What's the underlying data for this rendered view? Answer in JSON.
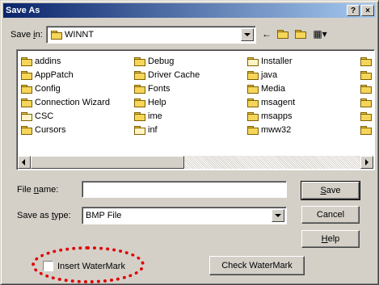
{
  "title": "Save As",
  "title_buttons": {
    "help": "?",
    "close": "×"
  },
  "save_in": {
    "label_prefix": "Save ",
    "label_u": "i",
    "label_suffix": "n:",
    "value": "WINNT"
  },
  "toolbar_icons": [
    "back-arrow-icon",
    "up-folder-icon",
    "new-folder-icon",
    "view-menu-icon"
  ],
  "files": {
    "col1": [
      "addins",
      "AppPatch",
      "Config",
      "Connection Wizard",
      "CSC",
      "Cursors"
    ],
    "col2": [
      "Debug",
      "Driver Cache",
      "Fonts",
      "Help",
      "ime",
      "inf"
    ],
    "col3": [
      "Installer",
      "java",
      "Media",
      "msagent",
      "msapps",
      "mww32"
    ]
  },
  "file_name": {
    "label_prefix": "File ",
    "label_u": "n",
    "label_suffix": "ame:",
    "value": ""
  },
  "save_as_type": {
    "label_prefix": "Save as ",
    "label_u": "t",
    "label_suffix": "ype:",
    "value": "BMP File"
  },
  "buttons": {
    "save_u": "S",
    "save_rest": "ave",
    "cancel": "Cancel",
    "help_u": "H",
    "help_rest": "elp",
    "check_watermark": "Check WaterMark"
  },
  "insert_watermark": {
    "label": "Insert WaterMark",
    "checked": false
  },
  "colors": {
    "face": "#d4d0c8",
    "title_start": "#0a246a",
    "title_end": "#a6caf0",
    "highlight": "#e00000"
  }
}
